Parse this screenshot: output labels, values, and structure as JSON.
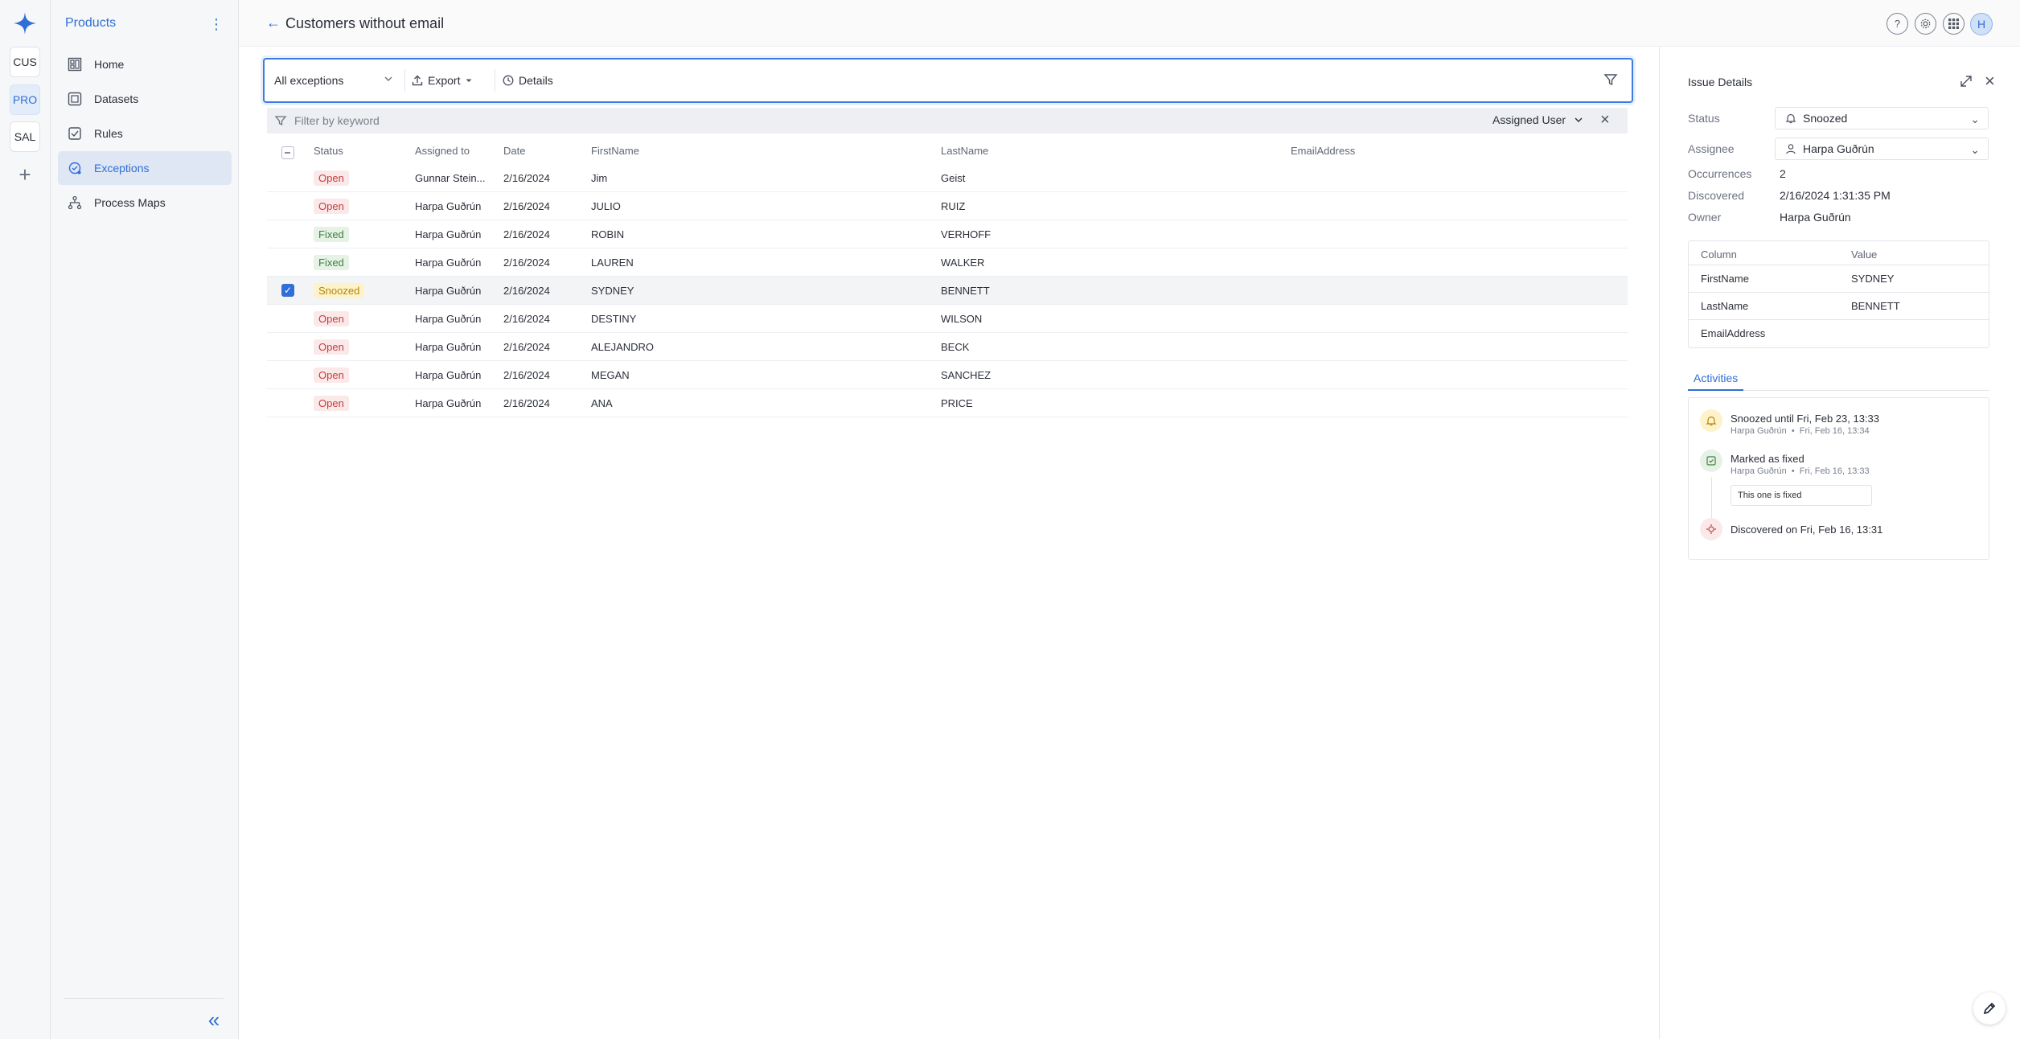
{
  "rail": {
    "workspaces": [
      {
        "label": "CUS",
        "active": false
      },
      {
        "label": "PRO",
        "active": true
      },
      {
        "label": "SAL",
        "active": false
      }
    ],
    "add_label": "+"
  },
  "sidebar": {
    "title": "Products",
    "items": [
      {
        "label": "Home",
        "icon": "dashboard-icon",
        "active": false
      },
      {
        "label": "Datasets",
        "icon": "dataset-icon",
        "active": false
      },
      {
        "label": "Rules",
        "icon": "rule-icon",
        "active": false
      },
      {
        "label": "Exceptions",
        "icon": "exception-icon",
        "active": true
      },
      {
        "label": "Process Maps",
        "icon": "process-map-icon",
        "active": false
      }
    ]
  },
  "header": {
    "title": "Customers without email",
    "avatar_initial": "H"
  },
  "toolbar": {
    "view_select": "All exceptions",
    "export_label": "Export",
    "details_label": "Details"
  },
  "filter": {
    "placeholder": "Filter by keyword",
    "assigned_user_label": "Assigned User"
  },
  "table": {
    "columns": [
      "Status",
      "Assigned to",
      "Date",
      "FirstName",
      "LastName",
      "EmailAddress"
    ],
    "rows": [
      {
        "status": "Open",
        "assigned": "Gunnar Stein...",
        "date": "2/16/2024",
        "first": "Jim",
        "last": "Geist",
        "email": "",
        "selected": false
      },
      {
        "status": "Open",
        "assigned": "Harpa Guðrún",
        "date": "2/16/2024",
        "first": "JULIO",
        "last": "RUIZ",
        "email": "",
        "selected": false
      },
      {
        "status": "Fixed",
        "assigned": "Harpa Guðrún",
        "date": "2/16/2024",
        "first": "ROBIN",
        "last": "VERHOFF",
        "email": "",
        "selected": false
      },
      {
        "status": "Fixed",
        "assigned": "Harpa Guðrún",
        "date": "2/16/2024",
        "first": "LAUREN",
        "last": "WALKER",
        "email": "",
        "selected": false
      },
      {
        "status": "Snoozed",
        "assigned": "Harpa Guðrún",
        "date": "2/16/2024",
        "first": "SYDNEY",
        "last": "BENNETT",
        "email": "",
        "selected": true
      },
      {
        "status": "Open",
        "assigned": "Harpa Guðrún",
        "date": "2/16/2024",
        "first": "DESTINY",
        "last": "WILSON",
        "email": "",
        "selected": false
      },
      {
        "status": "Open",
        "assigned": "Harpa Guðrún",
        "date": "2/16/2024",
        "first": "ALEJANDRO",
        "last": "BECK",
        "email": "",
        "selected": false
      },
      {
        "status": "Open",
        "assigned": "Harpa Guðrún",
        "date": "2/16/2024",
        "first": "MEGAN",
        "last": "SANCHEZ",
        "email": "",
        "selected": false
      },
      {
        "status": "Open",
        "assigned": "Harpa Guðrún",
        "date": "2/16/2024",
        "first": "ANA",
        "last": "PRICE",
        "email": "",
        "selected": false
      }
    ]
  },
  "panel": {
    "title": "Issue Details",
    "status_label": "Status",
    "status_value": "Snoozed",
    "assignee_label": "Assignee",
    "assignee_value": "Harpa Guðrún",
    "occurrences_label": "Occurrences",
    "occurrences_value": "2",
    "discovered_label": "Discovered",
    "discovered_value": "2/16/2024 1:31:35 PM",
    "owner_label": "Owner",
    "owner_value": "Harpa Guðrún",
    "kv_header": {
      "column": "Column",
      "value": "Value"
    },
    "kv_rows": [
      {
        "column": "FirstName",
        "value": "SYDNEY"
      },
      {
        "column": "LastName",
        "value": "BENNETT"
      },
      {
        "column": "EmailAddress",
        "value": ""
      }
    ],
    "tab_label": "Activities",
    "activities": [
      {
        "title": "Snoozed until Fri, Feb 23, 13:33",
        "user": "Harpa Guðrún",
        "time": "Fri, Feb 16, 13:34"
      },
      {
        "title": "Marked as fixed",
        "user": "Harpa Guðrún",
        "time": "Fri, Feb 16, 13:33",
        "note": "This one is fixed"
      },
      {
        "title": "Discovered on Fri, Feb 16, 13:31"
      }
    ]
  },
  "colors": {
    "accent": "#2f6fd6",
    "open": "#c43c3c",
    "fixed": "#3f7f3f",
    "snoozed": "#b38607"
  }
}
